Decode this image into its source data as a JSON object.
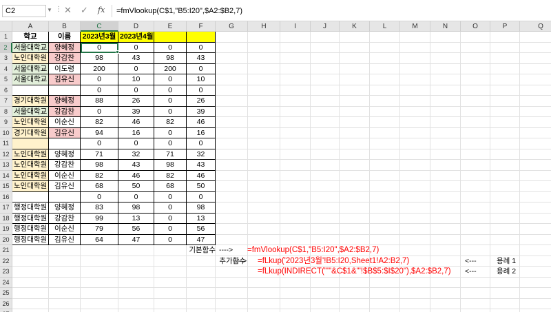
{
  "formula_bar": {
    "name_box": "C2",
    "cancel_glyph": "✕",
    "enter_glyph": "✓",
    "fx_label": "fx",
    "formula": "=fmVlookup(C$1,\"B5:I20\",$A2:$B2,7)"
  },
  "columns": [
    "A",
    "B",
    "C",
    "D",
    "E",
    "F",
    "G",
    "H",
    "I",
    "J",
    "K",
    "L",
    "M",
    "N",
    "O",
    "P",
    "Q"
  ],
  "selected_column": "C",
  "selected_row": 2,
  "colors": {
    "header_yellow": "#ffff00",
    "green_fill": "#e2efda",
    "pink_fill": "#f8cbcb",
    "cream_fill": "#fff2cc",
    "accent": "#217346",
    "formula_red": "#ff0000"
  },
  "rows": [
    {
      "num": 1,
      "cells": [
        "학교",
        "이름",
        "2023년3월",
        "2023년4월",
        "",
        ""
      ],
      "fills": [
        "",
        "",
        "yellow",
        "yellow",
        "yellow",
        "yellow"
      ]
    },
    {
      "num": 2,
      "cells": [
        "서울대학교",
        "양혜정",
        "0",
        "0",
        "0",
        "0"
      ],
      "fills": [
        "green",
        "pink",
        "",
        "",
        "",
        ""
      ]
    },
    {
      "num": 3,
      "cells": [
        "노인대학원",
        "강감찬",
        "98",
        "43",
        "98",
        "43"
      ],
      "fills": [
        "cream",
        "pink",
        "",
        "",
        "",
        ""
      ]
    },
    {
      "num": 4,
      "cells": [
        "서울대학교",
        "이도령",
        "200",
        "0",
        "200",
        "0"
      ],
      "fills": [
        "green",
        "",
        "",
        "",
        "",
        ""
      ]
    },
    {
      "num": 5,
      "cells": [
        "서울대학교",
        "김유신",
        "0",
        "10",
        "0",
        "10"
      ],
      "fills": [
        "green",
        "pink",
        "",
        "",
        "",
        ""
      ]
    },
    {
      "num": 6,
      "cells": [
        "",
        "",
        "0",
        "0",
        "0",
        "0"
      ],
      "fills": [
        "",
        "",
        "",
        "",
        "",
        ""
      ]
    },
    {
      "num": 7,
      "cells": [
        "경기대학원",
        "양혜정",
        "88",
        "26",
        "0",
        "26"
      ],
      "fills": [
        "cream",
        "pink",
        "",
        "",
        "",
        ""
      ]
    },
    {
      "num": 8,
      "cells": [
        "서울대학교",
        "강감찬",
        "0",
        "39",
        "0",
        "39"
      ],
      "fills": [
        "green",
        "pink",
        "",
        "",
        "",
        ""
      ]
    },
    {
      "num": 9,
      "cells": [
        "노인대학원",
        "이순신",
        "82",
        "46",
        "82",
        "46"
      ],
      "fills": [
        "cream",
        "",
        "",
        "",
        "",
        ""
      ]
    },
    {
      "num": 10,
      "cells": [
        "경기대학원",
        "김유신",
        "94",
        "16",
        "0",
        "16"
      ],
      "fills": [
        "cream",
        "pink",
        "",
        "",
        "",
        ""
      ]
    },
    {
      "num": 11,
      "cells": [
        "",
        "",
        "0",
        "0",
        "0",
        "0"
      ],
      "fills": [
        "cream",
        "",
        "",
        "",
        "",
        ""
      ]
    },
    {
      "num": 12,
      "cells": [
        "노인대학원",
        "양혜정",
        "71",
        "32",
        "71",
        "32"
      ],
      "fills": [
        "cream",
        "",
        "",
        "",
        "",
        ""
      ]
    },
    {
      "num": 13,
      "cells": [
        "노인대학원",
        "강감찬",
        "98",
        "43",
        "98",
        "43"
      ],
      "fills": [
        "cream",
        "",
        "",
        "",
        "",
        ""
      ]
    },
    {
      "num": 14,
      "cells": [
        "노인대학원",
        "이순신",
        "82",
        "46",
        "82",
        "46"
      ],
      "fills": [
        "cream",
        "",
        "",
        "",
        "",
        ""
      ]
    },
    {
      "num": 15,
      "cells": [
        "노인대학원",
        "김유신",
        "68",
        "50",
        "68",
        "50"
      ],
      "fills": [
        "cream",
        "",
        "",
        "",
        "",
        ""
      ]
    },
    {
      "num": 16,
      "cells": [
        "",
        "",
        "0",
        "0",
        "0",
        "0"
      ],
      "fills": [
        "",
        "",
        "",
        "",
        "",
        ""
      ]
    },
    {
      "num": 17,
      "cells": [
        "행정대학원",
        "양혜정",
        "83",
        "98",
        "0",
        "98"
      ],
      "fills": [
        "",
        "",
        "",
        "",
        "",
        ""
      ]
    },
    {
      "num": 18,
      "cells": [
        "행정대학원",
        "강감찬",
        "99",
        "13",
        "0",
        "13"
      ],
      "fills": [
        "",
        "",
        "",
        "",
        "",
        ""
      ]
    },
    {
      "num": 19,
      "cells": [
        "행정대학원",
        "이순신",
        "79",
        "56",
        "0",
        "56"
      ],
      "fills": [
        "",
        "",
        "",
        "",
        "",
        ""
      ]
    },
    {
      "num": 20,
      "cells": [
        "행정대학원",
        "김유신",
        "64",
        "47",
        "0",
        "47"
      ],
      "fills": [
        "",
        "",
        "",
        "",
        "",
        ""
      ]
    },
    {
      "num": 21,
      "cells": [],
      "fills": []
    },
    {
      "num": 22,
      "cells": [],
      "fills": []
    },
    {
      "num": 23,
      "cells": [],
      "fills": []
    },
    {
      "num": 24,
      "cells": [],
      "fills": []
    },
    {
      "num": 25,
      "cells": [],
      "fills": []
    },
    {
      "num": 26,
      "cells": [],
      "fills": []
    },
    {
      "num": 27,
      "cells": [],
      "fills": []
    }
  ],
  "annotations": [
    {
      "row": 21,
      "col": "F",
      "text": "기본함수",
      "align": "right",
      "color": "black"
    },
    {
      "row": 21,
      "col": "G",
      "text": "---->",
      "align": "left",
      "color": "black"
    },
    {
      "row": 21,
      "col": "G2",
      "text": "=fmVlookup(C$1,\"B5:I20\",$A2:$B2,7)",
      "align": "left",
      "color": "red"
    },
    {
      "row": 22,
      "col": "G",
      "text": "추가함수",
      "align": "right",
      "color": "black"
    },
    {
      "row": 22,
      "col": "H",
      "text": "---->",
      "align": "left",
      "color": "black"
    },
    {
      "row": 22,
      "col": "H2",
      "text": "=fLkup('2023년3월'!B5:I20,Sheet1!A2:B2,7)",
      "align": "left",
      "color": "red"
    },
    {
      "row": 22,
      "col": "O",
      "text": "<---",
      "align": "left",
      "color": "black"
    },
    {
      "row": 22,
      "col": "P",
      "text": "용례 1",
      "align": "center",
      "color": "black"
    },
    {
      "row": 23,
      "col": "H2",
      "text": "=fLkup(INDIRECT(\"'\"&C$1&\"'!$B$5:$I$20\"),$A2:$B2,7)",
      "align": "left",
      "color": "red"
    },
    {
      "row": 23,
      "col": "O",
      "text": "<---",
      "align": "left",
      "color": "black"
    },
    {
      "row": 23,
      "col": "P",
      "text": "용례 2",
      "align": "center",
      "color": "black"
    }
  ]
}
